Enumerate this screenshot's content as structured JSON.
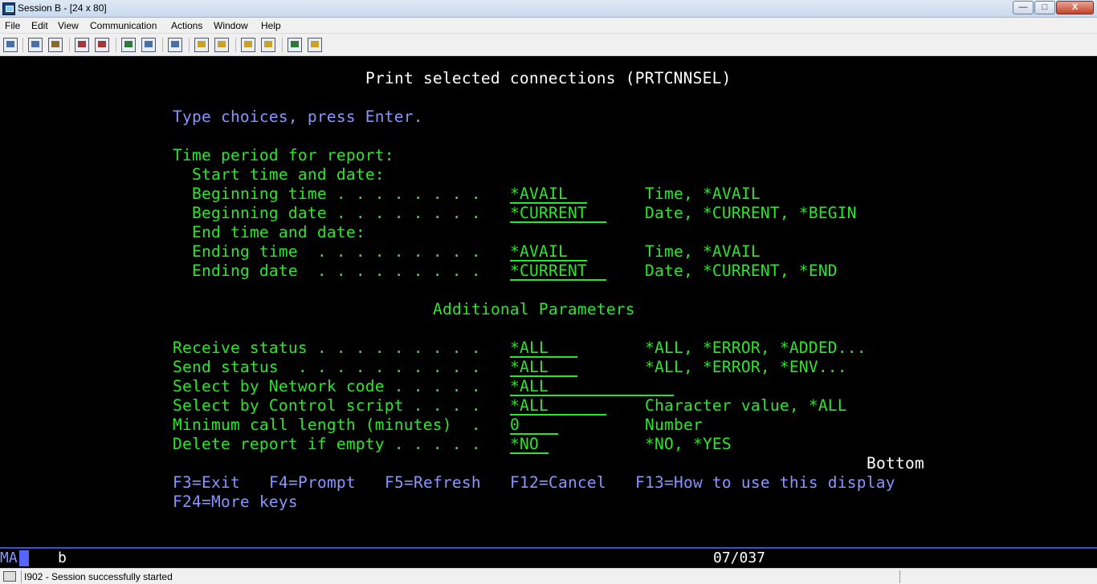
{
  "window": {
    "title": "Session B - [24 x 80]"
  },
  "menu": [
    "File",
    "Edit",
    "View",
    "Communication",
    "Actions",
    "Window",
    "Help"
  ],
  "toolbar": {
    "icons": [
      "print-screen-icon",
      "copy-icon",
      "paste-icon",
      "send-icon",
      "receive-icon",
      "display-icon",
      "keypad-icon",
      "macro-icon",
      "record-icon",
      "play-icon",
      "stop-icon",
      "run-icon",
      "customize-icon",
      "globe-icon",
      "help-icon"
    ]
  },
  "screen": {
    "title": "Print selected connections (PRTCNNSEL)",
    "instructions": "Type choices, press Enter.",
    "section_time": "Time period for report:",
    "start_label": "Start time and date:",
    "beginning_time_label": "Beginning time . . . . . . . .",
    "beginning_time_value": "*AVAIL",
    "beginning_time_hint": "Time, *AVAIL",
    "beginning_date_label": "Beginning date . . . . . . . .",
    "beginning_date_value": "*CURRENT",
    "beginning_date_hint": "Date, *CURRENT, *BEGIN",
    "end_label": "End time and date:",
    "ending_time_label": "Ending time  . . . . . . . . .",
    "ending_time_value": "*AVAIL",
    "ending_time_hint": "Time, *AVAIL",
    "ending_date_label": "Ending date  . . . . . . . . .",
    "ending_date_value": "*CURRENT",
    "ending_date_hint": "Date, *CURRENT, *END",
    "additional_title": "Additional Parameters",
    "receive_status_label": "Receive status . . . . . . . . .",
    "receive_status_value": "*ALL",
    "receive_status_hint": "*ALL, *ERROR, *ADDED...",
    "send_status_label": "Send status  . . . . . . . . . .",
    "send_status_value": "*ALL",
    "send_status_hint": "*ALL, *ERROR, *ENV...",
    "network_code_label": "Select by Network code . . . . .",
    "network_code_value": "*ALL",
    "control_script_label": "Select by Control script . . . .",
    "control_script_value": "*ALL",
    "control_script_hint": "Character value, *ALL",
    "min_call_label": "Minimum call length (minutes)  .",
    "min_call_value": "0",
    "min_call_hint": "Number",
    "delete_report_label": "Delete report if empty . . . . .",
    "delete_report_value": "*NO",
    "delete_report_hint": "*NO, *YES",
    "bottom": "Bottom",
    "fkeys": {
      "f3": "F3=Exit",
      "f4": "F4=Prompt",
      "f5": "F5=Refresh",
      "f12": "F12=Cancel",
      "f13": "F13=How to use this display",
      "f24": "F24=More keys"
    }
  },
  "oia": {
    "mode": "MA",
    "indicator": "b",
    "cursor_position": "07/037"
  },
  "status": {
    "message": "I902 - Session successfully started"
  },
  "colors": {
    "screen_bg": "#000000",
    "field_green": "#29e829",
    "label_blue": "#8b95ff",
    "heading_white": "#ffffff"
  }
}
